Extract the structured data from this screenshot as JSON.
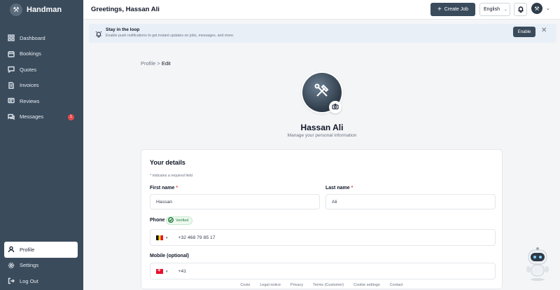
{
  "app": {
    "name": "Handman"
  },
  "sidebar": {
    "items": [
      {
        "label": "Dashboard",
        "icon": "grid-icon"
      },
      {
        "label": "Bookings",
        "icon": "calendar-icon"
      },
      {
        "label": "Quotes",
        "icon": "chat-icon"
      },
      {
        "label": "Invoices",
        "icon": "document-icon"
      },
      {
        "label": "Reviews",
        "icon": "review-icon"
      },
      {
        "label": "Messages",
        "icon": "messages-icon",
        "badge": "1"
      }
    ],
    "bottom": [
      {
        "label": "Profile",
        "icon": "user-icon",
        "active": true
      },
      {
        "label": "Settings",
        "icon": "gear-icon"
      },
      {
        "label": "Log Out",
        "icon": "logout-icon"
      }
    ]
  },
  "header": {
    "greeting": "Greetings, Hassan Ali",
    "create_label": "Create Job",
    "language": "English"
  },
  "banner": {
    "title": "Stay in the loop",
    "text": "Enable push notifications to get instant updates on jobs, messages, and more.",
    "enable_label": "Enable",
    "close_symbol": "✕"
  },
  "breadcrumb": {
    "parent": "Profile",
    "separator": ">",
    "current": "Edit"
  },
  "profile": {
    "name": "Hassan Ali",
    "subtitle": "Manage your personal information"
  },
  "details": {
    "title": "Your details",
    "required_note": "* indicates a required field",
    "first_name_label": "First name",
    "first_name_value": "Hassan",
    "last_name_label": "Last name",
    "last_name_value": "Ali",
    "required_star": "*",
    "phone_label": "Phone",
    "verified_label": "Verified",
    "phone_value": "+32 468 79 85 17",
    "mobile_label": "Mobile (optional)",
    "mobile_value": "+41"
  },
  "footer": [
    "Costs",
    "Legal notice",
    "Privacy",
    "Terms (Customer)",
    "Cookie settings",
    "Contact"
  ],
  "colors": {
    "sidebar": "#3a4b5c",
    "accent": "#3a4b5c",
    "badge": "#e54b4b",
    "verified": "#1f7a3a"
  }
}
